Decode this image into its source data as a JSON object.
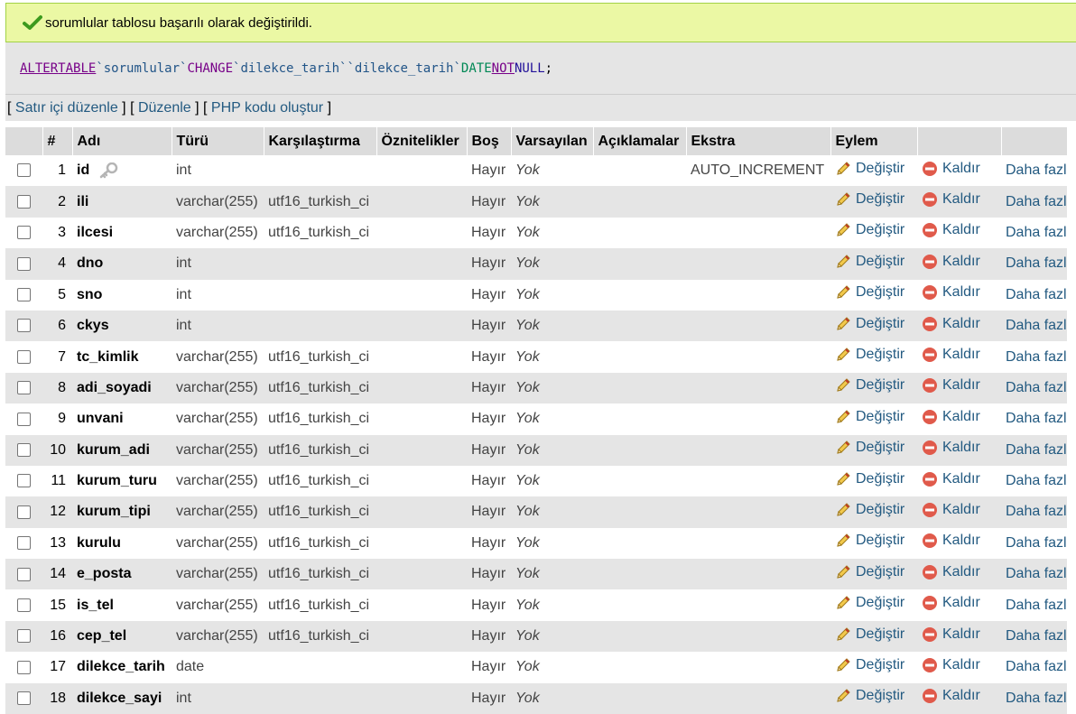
{
  "message": {
    "text": "sorumlular tablosu başarılı olarak değiştirildi."
  },
  "sql": {
    "kw_alter": "ALTER",
    "kw_table": "TABLE",
    "table": "`sorumlular`",
    "kw_change": "CHANGE",
    "col_old": "`dilekce_tarih`",
    "col_new": "`dilekce_tarih`",
    "kw_date": "DATE",
    "kw_not": "NOT",
    "kw_null": "NULL",
    "end": ";"
  },
  "actions": {
    "inline_edit": "Satır içi düzenle",
    "edit": "Düzenle",
    "php_code": "PHP kodu oluştur"
  },
  "columns": {
    "num": "#",
    "name": "Adı",
    "type": "Türü",
    "collation": "Karşılaştırma",
    "attributes": "Öznitelikler",
    "null": "Boş",
    "default": "Varsayılan",
    "comments": "Açıklamalar",
    "extra": "Ekstra",
    "action": "Eylem"
  },
  "action_labels": {
    "change": "Değiştir",
    "drop": "Kaldır",
    "more": "Daha fazla"
  },
  "rows": [
    {
      "num": "1",
      "name": "id",
      "type": "int",
      "collation": "",
      "null": "Hayır",
      "default": "Yok",
      "extra": "AUTO_INCREMENT",
      "primary_key": true
    },
    {
      "num": "2",
      "name": "ili",
      "type": "varchar(255)",
      "collation": "utf16_turkish_ci",
      "null": "Hayır",
      "default": "Yok",
      "extra": ""
    },
    {
      "num": "3",
      "name": "ilcesi",
      "type": "varchar(255)",
      "collation": "utf16_turkish_ci",
      "null": "Hayır",
      "default": "Yok",
      "extra": ""
    },
    {
      "num": "4",
      "name": "dno",
      "type": "int",
      "collation": "",
      "null": "Hayır",
      "default": "Yok",
      "extra": ""
    },
    {
      "num": "5",
      "name": "sno",
      "type": "int",
      "collation": "",
      "null": "Hayır",
      "default": "Yok",
      "extra": ""
    },
    {
      "num": "6",
      "name": "ckys",
      "type": "int",
      "collation": "",
      "null": "Hayır",
      "default": "Yok",
      "extra": ""
    },
    {
      "num": "7",
      "name": "tc_kimlik",
      "type": "varchar(255)",
      "collation": "utf16_turkish_ci",
      "null": "Hayır",
      "default": "Yok",
      "extra": ""
    },
    {
      "num": "8",
      "name": "adi_soyadi",
      "type": "varchar(255)",
      "collation": "utf16_turkish_ci",
      "null": "Hayır",
      "default": "Yok",
      "extra": ""
    },
    {
      "num": "9",
      "name": "unvani",
      "type": "varchar(255)",
      "collation": "utf16_turkish_ci",
      "null": "Hayır",
      "default": "Yok",
      "extra": ""
    },
    {
      "num": "10",
      "name": "kurum_adi",
      "type": "varchar(255)",
      "collation": "utf16_turkish_ci",
      "null": "Hayır",
      "default": "Yok",
      "extra": ""
    },
    {
      "num": "11",
      "name": "kurum_turu",
      "type": "varchar(255)",
      "collation": "utf16_turkish_ci",
      "null": "Hayır",
      "default": "Yok",
      "extra": ""
    },
    {
      "num": "12",
      "name": "kurum_tipi",
      "type": "varchar(255)",
      "collation": "utf16_turkish_ci",
      "null": "Hayır",
      "default": "Yok",
      "extra": ""
    },
    {
      "num": "13",
      "name": "kurulu",
      "type": "varchar(255)",
      "collation": "utf16_turkish_ci",
      "null": "Hayır",
      "default": "Yok",
      "extra": ""
    },
    {
      "num": "14",
      "name": "e_posta",
      "type": "varchar(255)",
      "collation": "utf16_turkish_ci",
      "null": "Hayır",
      "default": "Yok",
      "extra": ""
    },
    {
      "num": "15",
      "name": "is_tel",
      "type": "varchar(255)",
      "collation": "utf16_turkish_ci",
      "null": "Hayır",
      "default": "Yok",
      "extra": ""
    },
    {
      "num": "16",
      "name": "cep_tel",
      "type": "varchar(255)",
      "collation": "utf16_turkish_ci",
      "null": "Hayır",
      "default": "Yok",
      "extra": ""
    },
    {
      "num": "17",
      "name": "dilekce_tarih",
      "type": "date",
      "collation": "",
      "null": "Hayır",
      "default": "Yok",
      "extra": ""
    },
    {
      "num": "18",
      "name": "dilekce_sayi",
      "type": "int",
      "collation": "",
      "null": "Hayır",
      "default": "Yok",
      "extra": ""
    }
  ]
}
